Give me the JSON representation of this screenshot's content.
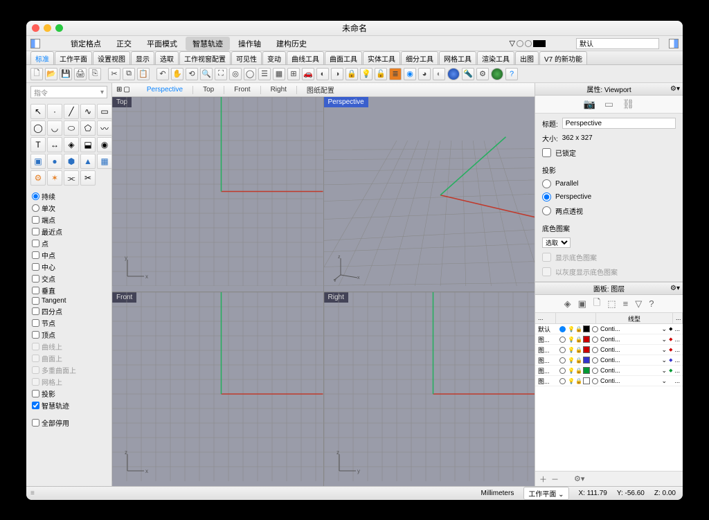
{
  "window": {
    "title": "未命名"
  },
  "menubar": {
    "items": [
      "锁定格点",
      "正交",
      "平面模式",
      "智慧轨迹",
      "操作轴",
      "建构历史"
    ],
    "activeIndex": 3,
    "layerDefault": "默认"
  },
  "tabset": {
    "tabs": [
      "标准",
      "工作平面",
      "设置视图",
      "显示",
      "选取",
      "工作视窗配置",
      "可见性",
      "变动",
      "曲线工具",
      "曲面工具",
      "实体工具",
      "细分工具",
      "网格工具",
      "渲染工具",
      "出图",
      "V7 的新功能"
    ],
    "selected": 0
  },
  "cmdPlaceholder": "指令",
  "osnap": {
    "mode": {
      "persist": "持续",
      "single": "单次",
      "selected": "persist"
    },
    "items": [
      "端点",
      "最近点",
      "点",
      "中点",
      "中心",
      "交点",
      "垂直",
      "Tangent",
      "四分点",
      "节点",
      "顶点"
    ],
    "dim": [
      "曲线上",
      "曲面上",
      "多重曲面上",
      "网格上"
    ],
    "extra": [
      "投影",
      "智慧轨迹"
    ],
    "checked": {
      "智慧轨迹": true
    },
    "disableAll": "全部停用"
  },
  "viewportTabs": [
    "Perspective",
    "Top",
    "Front",
    "Right",
    "图纸配置"
  ],
  "viewports": {
    "topleft": "Top",
    "topright": "Perspective",
    "botleft": "Front",
    "botright": "Right",
    "active": "Perspective"
  },
  "propsPanel": {
    "title": "属性: Viewport",
    "labelTitle": "标题:",
    "titleVal": "Perspective",
    "labelSize": "大小:",
    "sizeVal": "362 x 327",
    "locked": "已锁定",
    "proj": {
      "label": "投影",
      "parallel": "Parallel",
      "persp": "Perspective",
      "two": "两点透视",
      "selected": "persp"
    },
    "pattern": {
      "label": "底色图案",
      "select": "选取",
      "show": "显示底色图案",
      "gray": "以灰度显示底色图案"
    }
  },
  "layerPanel": {
    "title": "面板: 图层",
    "hdrLinetype": "线型",
    "rows": [
      {
        "name": "默认",
        "on": true,
        "color": "#000000",
        "mat": "#000000",
        "lt": "Conti..."
      },
      {
        "name": "图...",
        "on": false,
        "color": "#cc0000",
        "mat": "#cc0000",
        "lt": "Conti..."
      },
      {
        "name": "图...",
        "on": false,
        "color": "#cc0000",
        "mat": "#cc0000",
        "lt": "Conti..."
      },
      {
        "name": "图...",
        "on": false,
        "color": "#3333cc",
        "mat": "#3333cc",
        "lt": "Conti..."
      },
      {
        "name": "图...",
        "on": false,
        "color": "#009933",
        "mat": "#009933",
        "lt": "Conti..."
      },
      {
        "name": "图...",
        "on": false,
        "color": "#ffffff",
        "mat": "#ffffff",
        "lt": "Conti..."
      }
    ]
  },
  "statusbar": {
    "unit": "Millimeters",
    "cplane": "工作平面",
    "x": "X: 111.79",
    "y": "Y: -56.60",
    "z": "Z: 0.00"
  }
}
